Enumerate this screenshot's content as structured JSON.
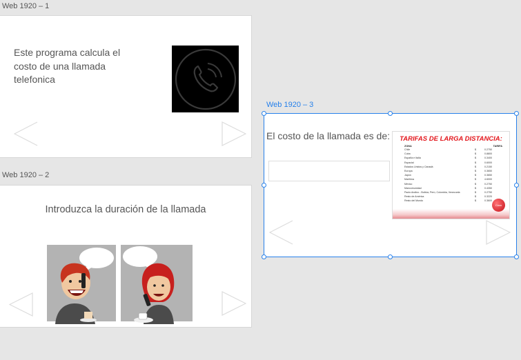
{
  "artboards": [
    {
      "title": "Web 1920 – 1",
      "description": "Este programa calcula el costo de una llamada telefonica",
      "image_icon": "phone-icon"
    },
    {
      "title": "Web 1920 – 2",
      "prompt": "Introduzca la duración de la llamada",
      "image": "people-talking-on-phone"
    },
    {
      "title": "Web 1920 – 3",
      "result_label": "El costo de la llamada es de:",
      "result_value": "",
      "rate_card": {
        "title": "TARIFAS DE LARGA DISTANCIA:",
        "col_zone": "ZONA",
        "col_rate": "TARIFA",
        "logo_text": "Claro",
        "rows": [
          {
            "zone": "Chile",
            "currency": "$",
            "value": "0.2750"
          },
          {
            "zone": "Cuba",
            "currency": "$",
            "value": "0.8800"
          },
          {
            "zone": "España e Italia",
            "currency": "$",
            "value": "0.3400"
          },
          {
            "zone": "Espacial",
            "currency": "$",
            "value": "0.6000"
          },
          {
            "zone": "Estados Unidos y Canadá",
            "currency": "$",
            "value": "0.2150"
          },
          {
            "zone": "Europa",
            "currency": "$",
            "value": "0.3650"
          },
          {
            "zone": "Japón",
            "currency": "$",
            "value": "0.3650"
          },
          {
            "zone": "Marítima",
            "currency": "$",
            "value": "4.6000"
          },
          {
            "zone": "México",
            "currency": "$",
            "value": "0.2750"
          },
          {
            "zone": "Mancomunidad",
            "currency": "$",
            "value": "0.4350"
          },
          {
            "zone": "Pacto Andino - Bolivia, Perú, Colombia, Venezuela",
            "currency": "$",
            "value": "0.2750"
          },
          {
            "zone": "Resto de América",
            "currency": "$",
            "value": "0.3220"
          },
          {
            "zone": "Resto del Mundo",
            "currency": "$",
            "value": "0.3600"
          }
        ]
      }
    }
  ],
  "colors": {
    "selection": "#2680eb",
    "canvas": "#e6e6e6",
    "artboard": "#ffffff",
    "text": "#555555",
    "rate_title": "#e3151b"
  }
}
